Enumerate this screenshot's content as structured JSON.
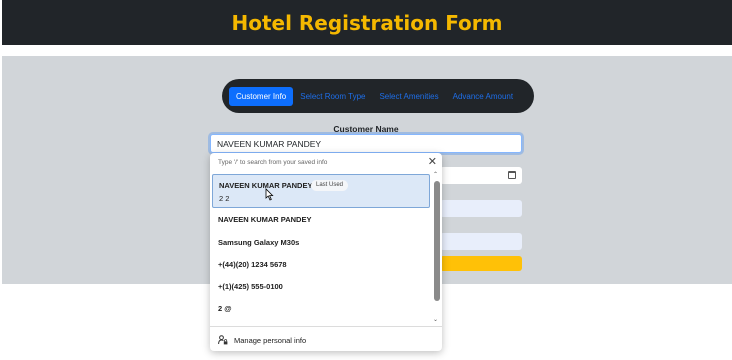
{
  "header": {
    "title": "Hotel Registration Form"
  },
  "tabs": [
    {
      "label": "Customer Info",
      "active": true
    },
    {
      "label": "Select Room Type",
      "active": false
    },
    {
      "label": "Select Amenities",
      "active": false
    },
    {
      "label": "Advance Amount",
      "active": false
    }
  ],
  "form": {
    "customer_name_label": "Customer Name",
    "customer_name_value": "NAVEEN KUMAR PANDEY"
  },
  "autofill": {
    "hint": "Type '/' to search from your saved info",
    "selected": {
      "name": "NAVEEN KUMAR PANDEY",
      "badge": "Last Used",
      "detail": "2 2"
    },
    "items": [
      "NAVEEN KUMAR PANDEY",
      "Samsung Galaxy M30s",
      "+(44)(20) 1234 5678",
      "+(1)(425) 555-0100",
      "2 @"
    ],
    "manage_label": "Manage personal info"
  },
  "colors": {
    "header_bg": "#212529",
    "header_text": "#f5b800",
    "panel_bg": "#d1d5d9",
    "tab_active": "#0d6efd",
    "submit": "#ffc107"
  }
}
